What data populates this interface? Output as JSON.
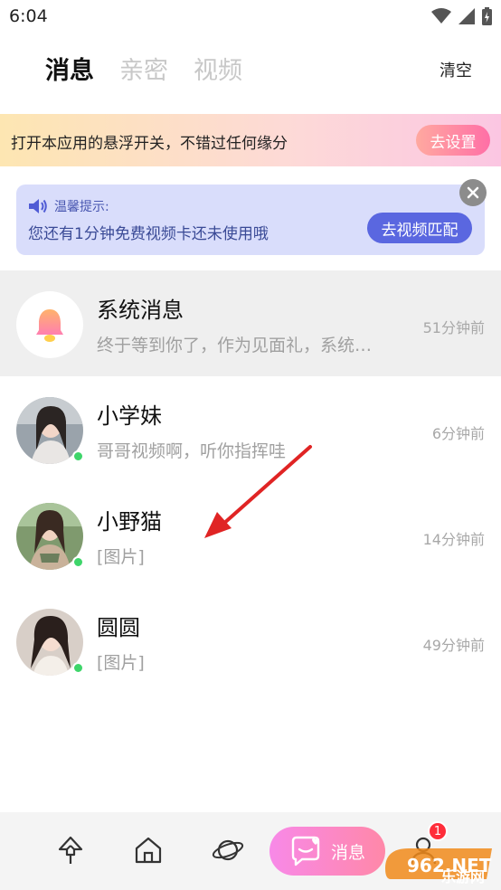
{
  "status_bar": {
    "time": "6:04"
  },
  "tabs": [
    {
      "label": "消息",
      "active": true
    },
    {
      "label": "亲密",
      "active": false
    },
    {
      "label": "视频",
      "active": false
    }
  ],
  "header": {
    "clear_label": "清空"
  },
  "float_banner": {
    "text": "打开本应用的悬浮开关，不错过任何缘分",
    "button": "去设置"
  },
  "tip": {
    "title": "温馨提示:",
    "body": "您还有1分钟免费视频卡还未使用哦",
    "button": "去视频匹配"
  },
  "conversations": [
    {
      "name": "系统消息",
      "preview": "终于等到你了，作为见面礼，系统…",
      "time": "51分钟前",
      "type": "system"
    },
    {
      "name": "小学妹",
      "preview": "哥哥视频啊，听你指挥哇",
      "time": "6分钟前",
      "online": true
    },
    {
      "name": "小野猫",
      "preview": "[图片]",
      "time": "14分钟前",
      "online": true
    },
    {
      "name": "圆圆",
      "preview": "[图片]",
      "time": "49分钟前",
      "online": true
    }
  ],
  "bottom_nav": {
    "items": [
      "tree-icon",
      "home-icon",
      "planet-icon",
      "chat-icon",
      "profile-icon"
    ],
    "active_label": "消息",
    "badge": "1"
  },
  "watermark": {
    "logo": "962.NET",
    "text": "乐游网"
  },
  "colors": {
    "accent": "#5a67e0",
    "online": "#3ed56a",
    "badge": "#ff2d3a",
    "arrow": "#e02424"
  }
}
